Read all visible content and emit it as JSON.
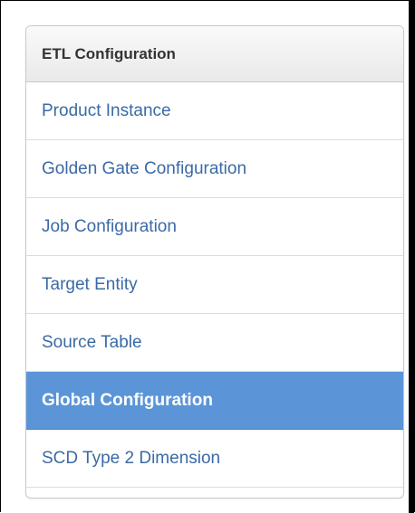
{
  "panel": {
    "title": "ETL Configuration"
  },
  "menu": {
    "items": [
      {
        "label": "Product Instance",
        "active": false
      },
      {
        "label": "Golden Gate Configuration",
        "active": false
      },
      {
        "label": "Job Configuration",
        "active": false
      },
      {
        "label": "Target Entity",
        "active": false
      },
      {
        "label": "Source Table",
        "active": false
      },
      {
        "label": "Global Configuration",
        "active": true
      },
      {
        "label": "SCD Type 2 Dimension",
        "active": false
      }
    ]
  },
  "colors": {
    "active_background": "#5b95d7",
    "link_text": "#3a6aa6",
    "header_text": "#333333"
  }
}
